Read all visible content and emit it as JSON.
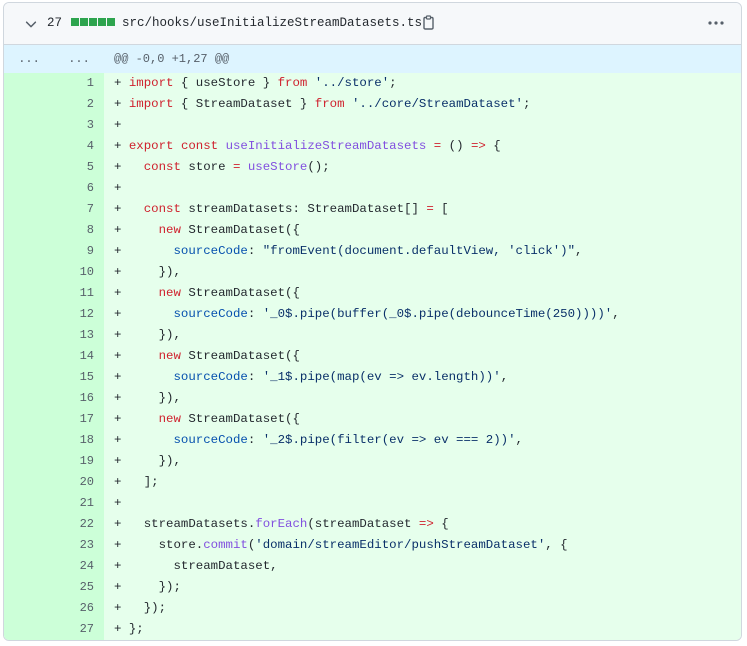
{
  "header": {
    "changes_count": "27",
    "file_path": "src/hooks/useInitializeStreamDatasets.ts"
  },
  "hunk": {
    "old_expand": "...",
    "new_expand": "...",
    "text": "@@ -0,0 +1,27 @@"
  },
  "lines": [
    {
      "n": "1",
      "tokens": [
        [
          "+ ",
          ""
        ],
        [
          "import",
          "k"
        ],
        [
          " { useStore } ",
          ""
        ],
        [
          "from",
          "k"
        ],
        [
          " ",
          ""
        ],
        [
          "'../store'",
          "s"
        ],
        [
          ";",
          ""
        ]
      ]
    },
    {
      "n": "2",
      "tokens": [
        [
          "+ ",
          ""
        ],
        [
          "import",
          "k"
        ],
        [
          " { StreamDataset } ",
          ""
        ],
        [
          "from",
          "k"
        ],
        [
          " ",
          ""
        ],
        [
          "'../core/StreamDataset'",
          "s"
        ],
        [
          ";",
          ""
        ]
      ]
    },
    {
      "n": "3",
      "tokens": [
        [
          "+",
          ""
        ]
      ]
    },
    {
      "n": "4",
      "tokens": [
        [
          "+ ",
          ""
        ],
        [
          "export",
          "k"
        ],
        [
          " ",
          ""
        ],
        [
          "const",
          "k"
        ],
        [
          " ",
          ""
        ],
        [
          "useInitializeStreamDatasets",
          "f"
        ],
        [
          " ",
          ""
        ],
        [
          "=",
          "k"
        ],
        [
          " () ",
          ""
        ],
        [
          "=>",
          "k"
        ],
        [
          " {",
          ""
        ]
      ]
    },
    {
      "n": "5",
      "tokens": [
        [
          "+   ",
          ""
        ],
        [
          "const",
          "k"
        ],
        [
          " store ",
          ""
        ],
        [
          "=",
          "k"
        ],
        [
          " ",
          ""
        ],
        [
          "useStore",
          "f"
        ],
        [
          "();",
          ""
        ]
      ]
    },
    {
      "n": "6",
      "tokens": [
        [
          "+",
          ""
        ]
      ]
    },
    {
      "n": "7",
      "tokens": [
        [
          "+   ",
          ""
        ],
        [
          "const",
          "k"
        ],
        [
          " streamDatasets: StreamDataset[] ",
          ""
        ],
        [
          "=",
          "k"
        ],
        [
          " [",
          ""
        ]
      ]
    },
    {
      "n": "8",
      "tokens": [
        [
          "+     ",
          ""
        ],
        [
          "new",
          "k"
        ],
        [
          " StreamDataset({",
          ""
        ]
      ]
    },
    {
      "n": "9",
      "tokens": [
        [
          "+       ",
          ""
        ],
        [
          "sourceCode",
          "p"
        ],
        [
          ": ",
          ""
        ],
        [
          "\"fromEvent(document.defaultView, 'click')\"",
          "s"
        ],
        [
          ",",
          ""
        ]
      ]
    },
    {
      "n": "10",
      "tokens": [
        [
          "+     }),",
          ""
        ]
      ]
    },
    {
      "n": "11",
      "tokens": [
        [
          "+     ",
          ""
        ],
        [
          "new",
          "k"
        ],
        [
          " StreamDataset({",
          ""
        ]
      ]
    },
    {
      "n": "12",
      "tokens": [
        [
          "+       ",
          ""
        ],
        [
          "sourceCode",
          "p"
        ],
        [
          ": ",
          ""
        ],
        [
          "'_0$.pipe(buffer(_0$.pipe(debounceTime(250))))'",
          "s"
        ],
        [
          ",",
          ""
        ]
      ]
    },
    {
      "n": "13",
      "tokens": [
        [
          "+     }),",
          ""
        ]
      ]
    },
    {
      "n": "14",
      "tokens": [
        [
          "+     ",
          ""
        ],
        [
          "new",
          "k"
        ],
        [
          " StreamDataset({",
          ""
        ]
      ]
    },
    {
      "n": "15",
      "tokens": [
        [
          "+       ",
          ""
        ],
        [
          "sourceCode",
          "p"
        ],
        [
          ": ",
          ""
        ],
        [
          "'_1$.pipe(map(ev => ev.length))'",
          "s"
        ],
        [
          ",",
          ""
        ]
      ]
    },
    {
      "n": "16",
      "tokens": [
        [
          "+     }),",
          ""
        ]
      ]
    },
    {
      "n": "17",
      "tokens": [
        [
          "+     ",
          ""
        ],
        [
          "new",
          "k"
        ],
        [
          " StreamDataset({",
          ""
        ]
      ]
    },
    {
      "n": "18",
      "tokens": [
        [
          "+       ",
          ""
        ],
        [
          "sourceCode",
          "p"
        ],
        [
          ": ",
          ""
        ],
        [
          "'_2$.pipe(filter(ev => ev === 2))'",
          "s"
        ],
        [
          ",",
          ""
        ]
      ]
    },
    {
      "n": "19",
      "tokens": [
        [
          "+     }),",
          ""
        ]
      ]
    },
    {
      "n": "20",
      "tokens": [
        [
          "+   ];",
          ""
        ]
      ]
    },
    {
      "n": "21",
      "tokens": [
        [
          "+",
          ""
        ]
      ]
    },
    {
      "n": "22",
      "tokens": [
        [
          "+   streamDatasets.",
          ""
        ],
        [
          "forEach",
          "f"
        ],
        [
          "(streamDataset ",
          ""
        ],
        [
          "=>",
          "k"
        ],
        [
          " {",
          ""
        ]
      ]
    },
    {
      "n": "23",
      "tokens": [
        [
          "+     store.",
          ""
        ],
        [
          "commit",
          "f"
        ],
        [
          "(",
          ""
        ],
        [
          "'domain/streamEditor/pushStreamDataset'",
          "s"
        ],
        [
          ", {",
          ""
        ]
      ]
    },
    {
      "n": "24",
      "tokens": [
        [
          "+       streamDataset,",
          ""
        ]
      ]
    },
    {
      "n": "25",
      "tokens": [
        [
          "+     });",
          ""
        ]
      ]
    },
    {
      "n": "26",
      "tokens": [
        [
          "+   });",
          ""
        ]
      ]
    },
    {
      "n": "27",
      "tokens": [
        [
          "+ };",
          ""
        ]
      ]
    }
  ],
  "colors": {
    "added_bg": "#e6ffec",
    "added_num_bg": "#ccffd8",
    "hunk_bg": "#ddf4ff",
    "diffstat_green": "#2da44e"
  },
  "icons": [
    "chevron-down-icon",
    "copy-icon",
    "kebab-menu-icon"
  ]
}
